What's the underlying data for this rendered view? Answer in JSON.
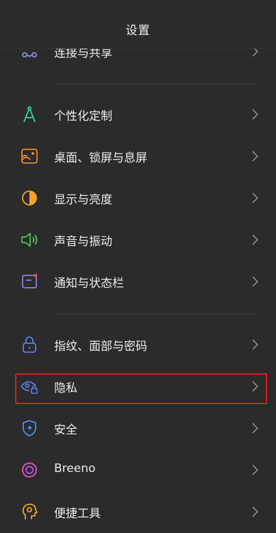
{
  "header": {
    "title": "设置"
  },
  "items": [
    {
      "label": "连接与共享",
      "icon": "connection-share-icon",
      "color": "#8a8fe0"
    },
    {
      "label": "个性化定制",
      "icon": "compass-icon",
      "color": "#3dd49b"
    },
    {
      "label": "桌面、锁屏与息屏",
      "icon": "wallpaper-icon",
      "color": "#f08a2e"
    },
    {
      "label": "显示与亮度",
      "icon": "brightness-icon",
      "color": "#f3a32b"
    },
    {
      "label": "声音与振动",
      "icon": "speaker-icon",
      "color": "#4fc25a"
    },
    {
      "label": "通知与状态栏",
      "icon": "notification-icon",
      "color": "#8d7fe8"
    },
    {
      "label": "指纹、面部与密码",
      "icon": "lock-icon",
      "color": "#5f7cf0"
    },
    {
      "label": "隐私",
      "icon": "privacy-eye-icon",
      "color": "#5f7cf0"
    },
    {
      "label": "安全",
      "icon": "shield-bolt-icon",
      "color": "#4a8df2"
    },
    {
      "label": "Breeno",
      "icon": "breeno-icon",
      "color": "#e24dbb"
    },
    {
      "label": "便捷工具",
      "icon": "tools-head-icon",
      "color": "#f3a32b"
    }
  ],
  "highlight_color": "#d81e1e"
}
